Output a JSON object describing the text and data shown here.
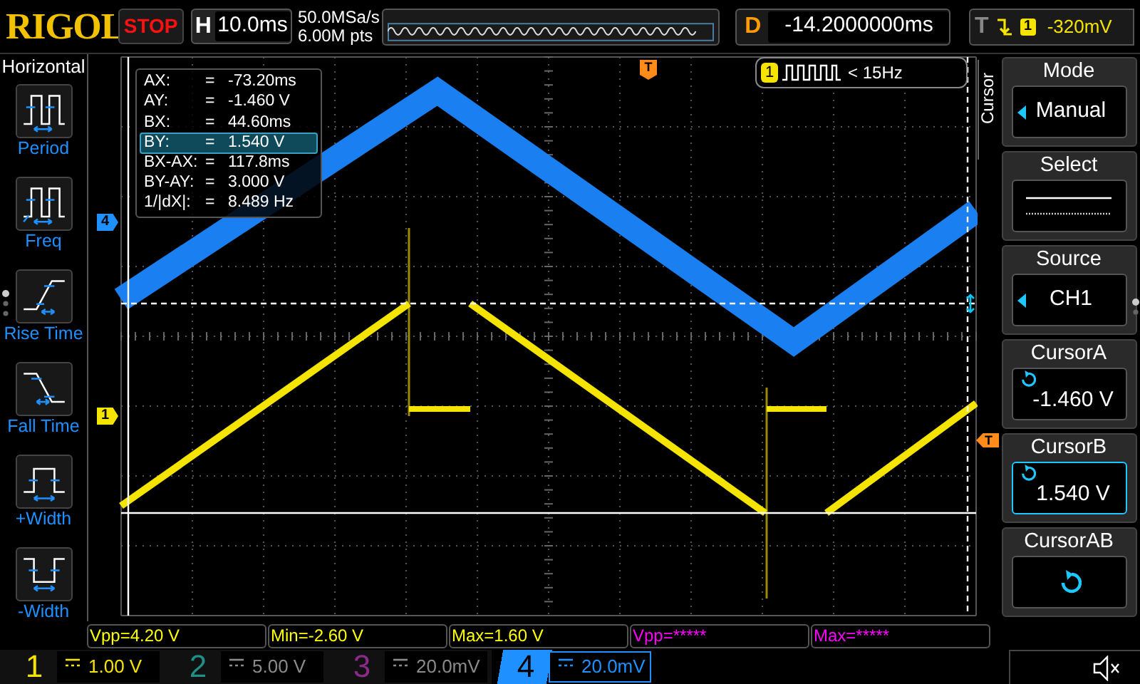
{
  "brand": "RIGOL",
  "run_state": "STOP",
  "horizontal": {
    "label": "H",
    "timebase": "10.0ms"
  },
  "acquisition": {
    "sample_rate": "50.0MSa/s",
    "memory_depth": "6.00M pts"
  },
  "delay": {
    "label": "D",
    "value": "-14.2000000ms"
  },
  "trigger": {
    "label": "T",
    "source": "1",
    "level": "-320mV"
  },
  "left_menu": {
    "title": "Horizontal",
    "items": [
      {
        "kind": "period",
        "label": "Period"
      },
      {
        "kind": "freq",
        "label": "Freq"
      },
      {
        "kind": "rise",
        "label": "Rise Time"
      },
      {
        "kind": "fall",
        "label": "Fall Time"
      },
      {
        "kind": "pwidth",
        "label": "+Width"
      },
      {
        "kind": "nwidth",
        "label": "-Width"
      }
    ]
  },
  "cursor_readout": [
    {
      "label": "AX:",
      "sign": "=",
      "value": "-73.20ms",
      "selected": false
    },
    {
      "label": "AY:",
      "sign": "=",
      "value": "-1.460 V",
      "selected": false
    },
    {
      "label": "BX:",
      "sign": "=",
      "value": "44.60ms",
      "selected": false
    },
    {
      "label": "BY:",
      "sign": "=",
      "value": "1.540 V",
      "selected": true
    },
    {
      "label": "BX-AX:",
      "sign": "=",
      "value": "117.8ms",
      "selected": false
    },
    {
      "label": "BY-AY:",
      "sign": "=",
      "value": "3.000 V",
      "selected": false
    },
    {
      "label": "1/|dX|:",
      "sign": "=",
      "value": "8.489 Hz",
      "selected": false
    }
  ],
  "frequency_badge": {
    "channel": "1",
    "value": "< 15Hz"
  },
  "markers": {
    "channel_4": "4",
    "channel_1": "1",
    "trigger_position": "T",
    "trigger_level": "T"
  },
  "right_menu": {
    "title": "Cursor",
    "items": [
      {
        "kind": "select",
        "title": "Mode",
        "value": "Manual",
        "selected": false
      },
      {
        "kind": "lines",
        "title": "Select",
        "selected": false
      },
      {
        "kind": "select",
        "title": "Source",
        "value": "CH1",
        "selected": false
      },
      {
        "kind": "knob",
        "title": "CursorA",
        "value": "-1.460 V",
        "selected": false
      },
      {
        "kind": "knob",
        "title": "CursorB",
        "value": "1.540 V",
        "selected": true
      },
      {
        "kind": "knob",
        "title": "CursorAB",
        "selected": false
      }
    ]
  },
  "measurements": [
    {
      "text": "Vpp=4.20 V",
      "color": "#ffff00"
    },
    {
      "text": "Min=-2.60 V",
      "color": "#ffff00"
    },
    {
      "text": "Max=1.60 V",
      "color": "#ffff00"
    },
    {
      "text": "Vpp=*****",
      "color": "#ff00ff"
    },
    {
      "text": "Max=*****",
      "color": "#ff00ff"
    }
  ],
  "channels": [
    {
      "number": "1",
      "scale": "1.00 V",
      "on": true,
      "selected": false,
      "color": "#f5e400"
    },
    {
      "number": "2",
      "scale": "5.00 V",
      "on": false,
      "selected": false,
      "color": "#1f8f88"
    },
    {
      "number": "3",
      "scale": "20.0mV",
      "on": false,
      "selected": false,
      "color": "#8a2a8a"
    },
    {
      "number": "4",
      "scale": "20.0mV",
      "on": true,
      "selected": true,
      "color": "#1e90ff"
    }
  ]
}
